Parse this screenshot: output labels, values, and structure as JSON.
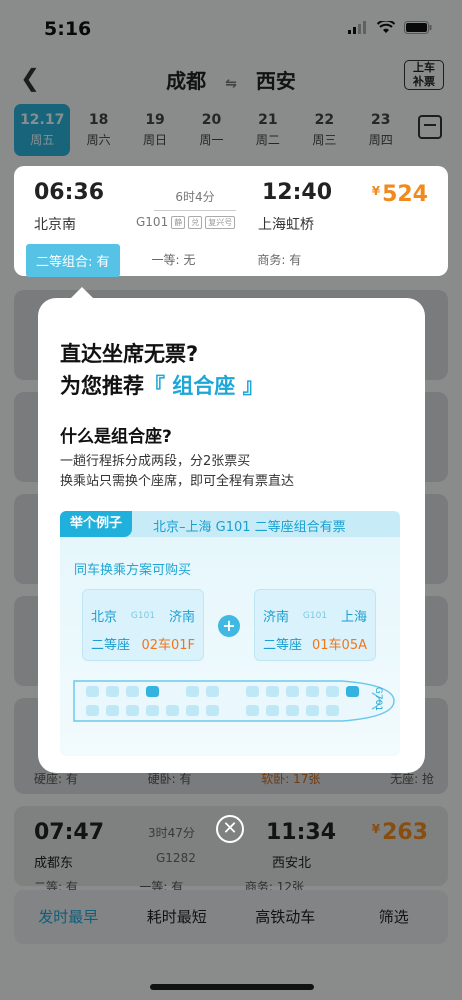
{
  "status_bar": {
    "time": "5:16"
  },
  "header": {
    "from": "成都",
    "to": "西安",
    "swap_icon": "swap-arrows-icon",
    "badge_line1": "上车",
    "badge_line2": "补票"
  },
  "dates": [
    {
      "date": "12.17",
      "weekday": "周五",
      "selected": true
    },
    {
      "date": "18",
      "weekday": "周六"
    },
    {
      "date": "19",
      "weekday": "周日"
    },
    {
      "date": "20",
      "weekday": "周一"
    },
    {
      "date": "21",
      "weekday": "周二"
    },
    {
      "date": "22",
      "weekday": "周三"
    },
    {
      "date": "23",
      "weekday": "周四"
    }
  ],
  "highlight_train": {
    "depart_time": "06:36",
    "depart_station": "北京南",
    "arrive_time": "12:40",
    "arrive_station": "上海虹桥",
    "duration": "6时4分",
    "train_no": "G101",
    "tags": [
      "静",
      "兑",
      "复兴号"
    ],
    "currency": "¥",
    "price": "524",
    "seat1": "二等组合: 有",
    "seat2": "一等: 无",
    "seat3": "商务: 有"
  },
  "popup": {
    "title_line1": "直达坐席无票?",
    "title_line2_prefix": "为您推荐",
    "title_line2_highlight": "『 组合座 』",
    "question": "什么是组合座?",
    "desc_line1": "一趟行程拆分成两段，分2张票买",
    "desc_line2": "换乘站只需换个座席，即可全程有票直达",
    "example_badge": "举个例子",
    "example_title": "北京–上海 G101 二等座组合有票",
    "example_note": "同车换乘方案可购买",
    "segment1": {
      "from": "北京",
      "train": "G101",
      "to": "济南",
      "seat_type": "二等座",
      "seat_no": "02车01F"
    },
    "segment2": {
      "from": "济南",
      "train": "G101",
      "to": "上海",
      "seat_type": "二等座",
      "seat_no": "01车05A"
    },
    "train_label": "G701"
  },
  "bg_train": {
    "row_labels": [
      "硬座: 有",
      "硬卧: 有",
      "软卧: 17张",
      "无座: 抢"
    ],
    "depart_time": "07:47",
    "depart_station": "成都东",
    "arrive_time": "11:34",
    "arrive_station": "西安北",
    "duration": "3时47分",
    "train_no": "G1282",
    "currency": "¥",
    "price": "263",
    "seat1": "二等: 有",
    "seat2": "一等: 有",
    "seat3": "商务: 12张"
  },
  "bottom_tabs": [
    {
      "label": "发时最早",
      "active": true
    },
    {
      "label": "耗时最短"
    },
    {
      "label": "高铁动车"
    },
    {
      "label": "筛选"
    }
  ],
  "colors": {
    "accent": "#1ea6d6",
    "price": "#f08a1c"
  }
}
